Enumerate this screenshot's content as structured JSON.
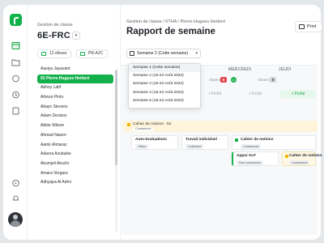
{
  "breadcrumb_small": "Gestion de classe",
  "class_name": "6E-FRC",
  "class_dropdown_glyph": "▾",
  "pills": [
    {
      "label": "12 élèves"
    },
    {
      "label": "PR-A2C"
    }
  ],
  "students": [
    "Aasiya Jayavant",
    "02 Pierre-Hugues Herbert",
    "Abhoy Latif",
    "Afonso Pinto",
    "Abayo Stevens",
    "Adam Denisov",
    "Abbie Wilson",
    "Ahmad Nazeri",
    "Aamir Almaraz",
    "Adaora Azubuike",
    "Akumjeli Akuchi",
    "Amara Vergara",
    "Adhyapa Al Admi"
  ],
  "selected_student_index": 1,
  "breadcrumb": "Gestion de classe / 6THA / Pierre-Hugues Herbert",
  "page_title": "Rapport de semaine",
  "print_label": "Print",
  "week_select": {
    "value": "Semaine 2 (Cette semaine)",
    "chevron": "▾"
  },
  "week_options": [
    "Semaine 1 (Cette semaine)",
    "Semaine 2 (16-22 Août 2023)",
    "Semaine 3 (16-22 Août 2023)",
    "Semaine 4 (16-22 Août 2023)",
    "Semaine 5 (16-22 Août 2023)"
  ],
  "days": [
    {
      "label": "MERCREDI",
      "number": "13"
    },
    {
      "label": "JEUDI"
    }
  ],
  "absent_label": "Absent",
  "absent_counts": [
    "0",
    "0"
  ],
  "add_labels": [
    "+ Fiché",
    "+ Fiché",
    "+ Fiché"
  ],
  "banner": {
    "title": "Cahier de notions - 04",
    "tag": "Contractuel"
  },
  "cards": [
    {
      "title": "Auto-évaluations",
      "tag": "Offres"
    },
    {
      "title": "Travail individuel",
      "tag": "Collective"
    },
    {
      "title": "Cahier de notions",
      "tag": "Contractuel"
    },
    {
      "title": "Appui ALF",
      "tag": "Non contractuel"
    },
    {
      "title": "Cahier de notions",
      "tag": "Contractuel"
    }
  ],
  "colors": {
    "accent": "#14b04b",
    "absent_badge": "#e5484d",
    "note_yellow": "#f5b400"
  },
  "icons": [
    "logo-icon",
    "calendar-icon",
    "folder-icon",
    "chat-icon",
    "clock-icon",
    "report-icon",
    "play-icon",
    "bell-icon",
    "print-icon"
  ]
}
